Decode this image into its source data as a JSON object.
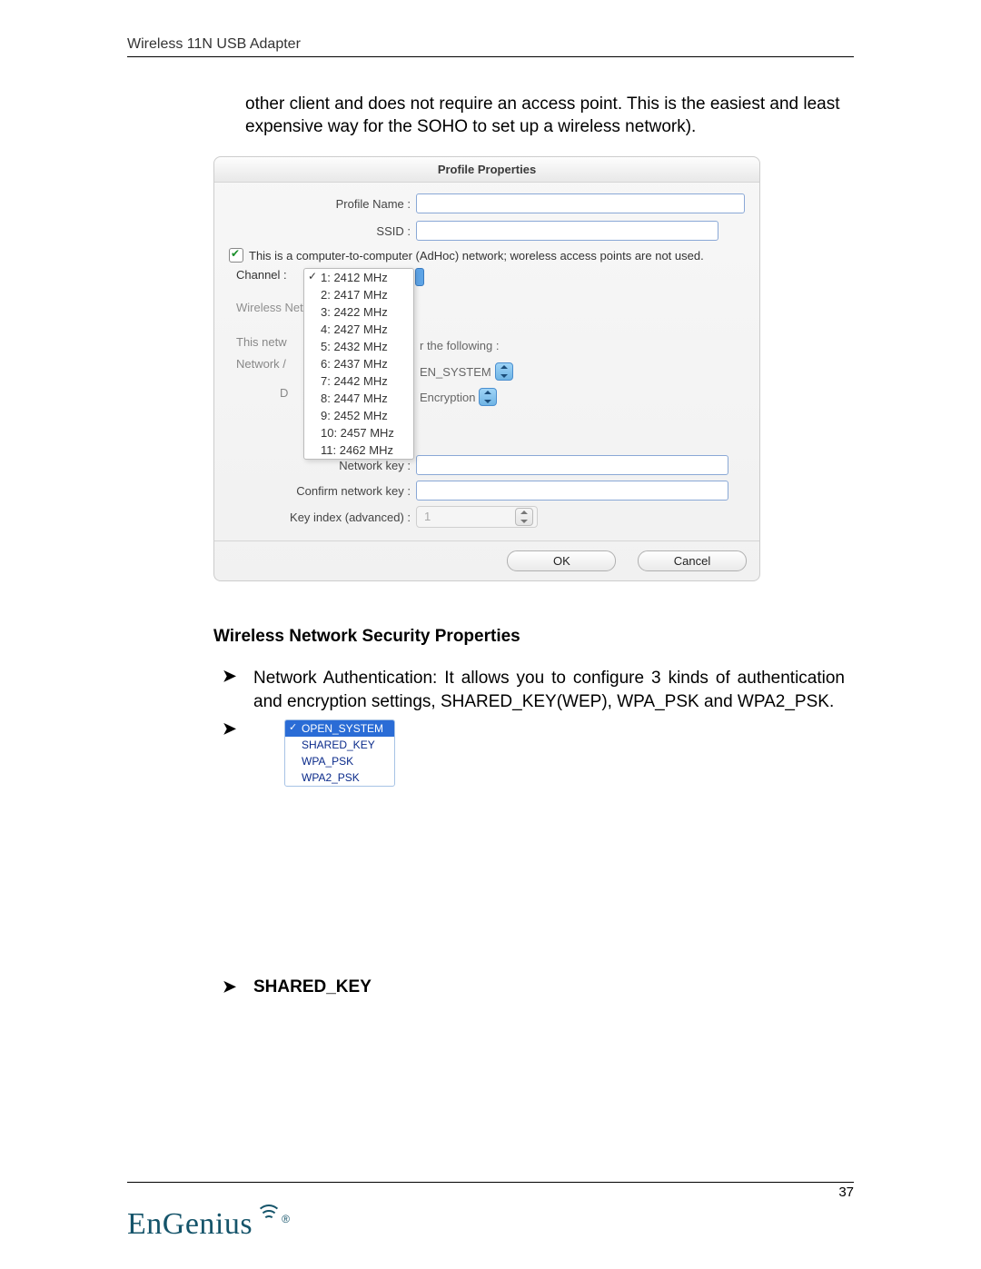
{
  "header": {
    "title": "Wireless 11N USB Adapter"
  },
  "intro": "other client and does not require an access point. This is the easiest and least expensive way for the SOHO to set up a wireless network).",
  "dialog": {
    "title": "Profile Properties",
    "profile_name_label": "Profile Name :",
    "ssid_label": "SSID :",
    "adhoc": "This is a computer-to-computer (AdHoc) network; woreless access points are not used.",
    "channel_label": "Channel :",
    "wireless_net_label": "Wireless Net",
    "this_netw_label": "This netw",
    "network_slash_label": "Network /",
    "d_label": "D",
    "following_label": "r the following :",
    "ensystem_label": "EN_SYSTEM",
    "encryption_label": "Encryption",
    "channels": [
      "1: 2412 MHz",
      "2: 2417 MHz",
      "3: 2422 MHz",
      "4: 2427 MHz",
      "5: 2432 MHz",
      "6: 2437 MHz",
      "7: 2442 MHz",
      "8: 2447 MHz",
      "9: 2452 MHz",
      "10: 2457 MHz",
      "11: 2462 MHz"
    ],
    "network_key_label": "Network key :",
    "confirm_key_label": "Confirm network key :",
    "key_index_label": "Key index (advanced) :",
    "key_index_value": "1",
    "ok": "OK",
    "cancel": "Cancel"
  },
  "section": {
    "heading": "Wireless Network Security Properties",
    "bullet1": "Network Authentication: It allows you to configure 3 kinds of authentication and encryption settings, SHARED_KEY(WEP), WPA_PSK and WPA2_PSK.",
    "auth_menu": [
      "OPEN_SYSTEM",
      "SHARED_KEY",
      "WPA_PSK",
      "WPA2_PSK"
    ],
    "shared_key_heading": "SHARED_KEY"
  },
  "footer": {
    "page": "37",
    "brand": "EnGenius"
  }
}
